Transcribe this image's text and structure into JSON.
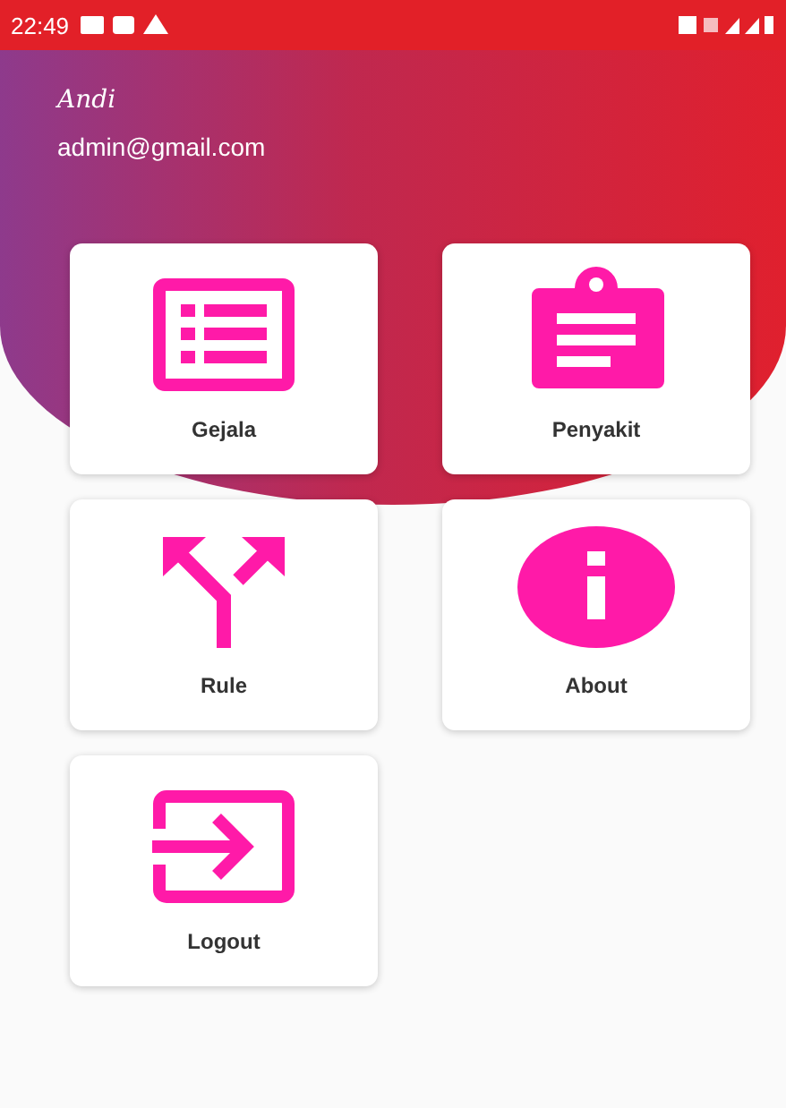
{
  "status_bar": {
    "time": "22:49"
  },
  "header": {
    "name": "Andi",
    "email": "admin@gmail.com"
  },
  "menu": [
    {
      "label": "Gejala",
      "kind": "list"
    },
    {
      "label": "Penyakit",
      "kind": "clipboard"
    },
    {
      "label": "Rule",
      "kind": "fork"
    },
    {
      "label": "About",
      "kind": "info"
    },
    {
      "label": "Logout",
      "kind": "login"
    }
  ]
}
